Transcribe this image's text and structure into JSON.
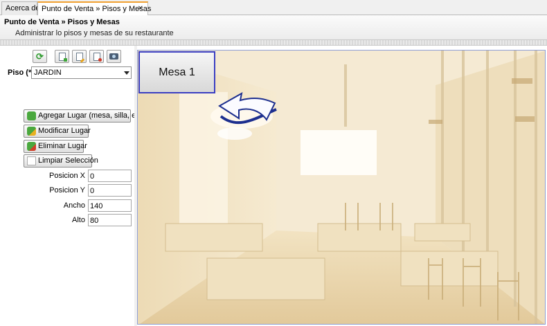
{
  "tabs": [
    {
      "label": "Acerca de"
    },
    {
      "label": "Punto de Venta » Pisos y Mesas",
      "close": "✕"
    }
  ],
  "header": {
    "title": "Punto de Venta » Pisos y Mesas",
    "subtitle": "Administrar lo pisos y mesas de su restaurante"
  },
  "toolbar": {
    "icons": [
      "refresh-icon",
      "add-document-icon",
      "edit-document-icon",
      "delete-document-icon",
      "camera-icon"
    ]
  },
  "piso": {
    "label": "Piso (*)",
    "selected": "JARDIN"
  },
  "actions": {
    "agregar": "Agregar Lugar (mesa, silla, etc)",
    "modificar": "Modificar Lugar",
    "eliminar": "Eliminar Lugar",
    "limpiar": "Limpiar Selección"
  },
  "fields": {
    "posx_label": "Posicion X",
    "posx_value": "0",
    "posy_label": "Posicion Y",
    "posy_value": "0",
    "ancho_label": "Ancho",
    "ancho_value": "140",
    "alto_label": "Alto",
    "alto_value": "80"
  },
  "canvas": {
    "mesa_label": "Mesa 1",
    "selection_color": "#3a3ec2",
    "arrow_color": "#1d2f8f"
  }
}
